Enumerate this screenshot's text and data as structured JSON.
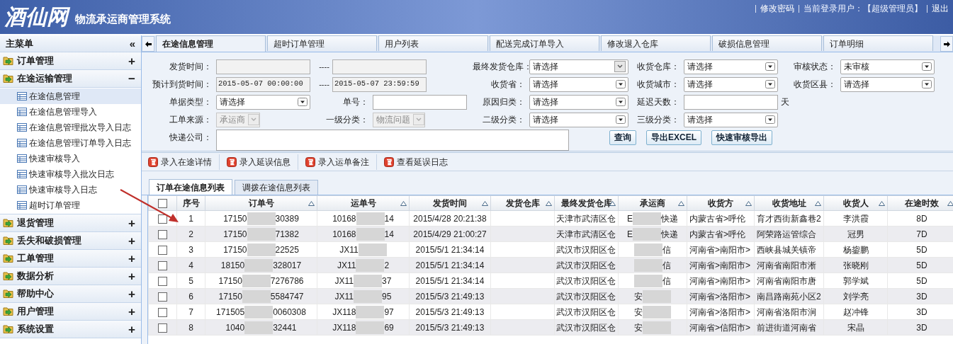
{
  "header": {
    "logo": "酒仙网",
    "title": "物流承运商管理系统",
    "links": [
      {
        "kind": "link",
        "text": "修改密码"
      },
      {
        "kind": "text",
        "text": "当前登录用户：【超级管理员】"
      },
      {
        "kind": "link",
        "text": "退出"
      }
    ]
  },
  "sidebar": {
    "title": "主菜单",
    "collapse": "«",
    "groups": [
      {
        "label": "订单管理",
        "toggle": "+"
      },
      {
        "label": "在途运输管理",
        "toggle": "−",
        "items": [
          {
            "label": "在途信息管理",
            "selected": true
          },
          {
            "label": "在途信息管理导入",
            "selected": false
          },
          {
            "label": "在途信息管理批次导入日志",
            "selected": false
          },
          {
            "label": "在途信息管理订单导入日志",
            "selected": false
          },
          {
            "label": "快速审核导入",
            "selected": false
          },
          {
            "label": "快速审核导入批次日志",
            "selected": false
          },
          {
            "label": "快速审核导入日志",
            "selected": false
          },
          {
            "label": "超时订单管理",
            "selected": false
          }
        ]
      },
      {
        "label": "退货管理",
        "toggle": "+"
      },
      {
        "label": "丢失和破损管理",
        "toggle": "+"
      },
      {
        "label": "工单管理",
        "toggle": "+"
      },
      {
        "label": "数据分析",
        "toggle": "+"
      },
      {
        "label": "帮助中心",
        "toggle": "+"
      },
      {
        "label": "用户管理",
        "toggle": "+"
      },
      {
        "label": "系统设置",
        "toggle": "+"
      }
    ]
  },
  "tabs": [
    {
      "label": "在途信息管理",
      "selected": true
    },
    {
      "label": "超时订单管理",
      "selected": false
    },
    {
      "label": "用户列表",
      "selected": false
    },
    {
      "label": "配送完成订单导入",
      "selected": false
    },
    {
      "label": "修改退入仓库",
      "selected": false
    },
    {
      "label": "破损信息管理",
      "selected": false
    },
    {
      "label": "订单明细",
      "selected": false
    }
  ],
  "form": {
    "rows": [
      [
        {
          "kind": "date_range",
          "label": "发货时间：",
          "separator": "----"
        },
        {
          "kind": "select_plain",
          "label": "最终发货仓库：",
          "value": "请选择"
        },
        {
          "kind": "select",
          "label": "收货仓库：",
          "value": "请选择"
        },
        {
          "kind": "select",
          "label": "审核状态：",
          "value": "未审核"
        }
      ],
      [
        {
          "kind": "date_range",
          "label": "预计到货时间：",
          "from": "2015-05-07 00:00:00",
          "to": "2015-05-07 23:59:59",
          "separator": "----"
        },
        {
          "kind": "select",
          "label": "收货省：",
          "value": "请选择"
        },
        {
          "kind": "select",
          "label": "收货城市：",
          "value": "请选择"
        },
        {
          "kind": "select",
          "label": "收货区县：",
          "value": "请选择"
        }
      ],
      [
        {
          "kind": "select",
          "label": "单据类型：",
          "value": "请选择"
        },
        {
          "kind": "text",
          "label": "单号："
        },
        {
          "kind": "select",
          "label": "原因归类：",
          "value": "请选择"
        },
        {
          "kind": "text",
          "label": "延迟天数：",
          "suffix": "天"
        }
      ],
      [
        {
          "kind": "disabled_select",
          "label": "工单来源：",
          "value": "承运商"
        },
        {
          "kind": "disabled_select",
          "label": "一级分类：",
          "value": "物流问题"
        },
        {
          "kind": "select",
          "label": "二级分类：",
          "value": "请选择"
        },
        {
          "kind": "select",
          "label": "三级分类：",
          "value": "请选择"
        }
      ],
      [
        {
          "kind": "textarea",
          "label": "快递公司："
        }
      ]
    ],
    "buttons": [
      "查询",
      "导出EXCEL",
      "快速审核导出"
    ]
  },
  "toolbar": [
    "录入在途详情",
    "录入延误信息",
    "录入运单备注",
    "查看延误日志"
  ],
  "list_tabs": [
    {
      "label": "订单在途信息列表",
      "selected": true
    },
    {
      "label": "调拨在途信息列表",
      "selected": false
    }
  ],
  "table": {
    "header_checked": false,
    "columns": [
      "序号",
      "订单号",
      "运单号",
      "发货时间",
      "发货仓库",
      "最终发货仓库",
      "承运商",
      "收货方",
      "收货地址",
      "收货人",
      "在途时效"
    ],
    "rows": [
      {
        "checked": false,
        "no": "1",
        "order": {
          "pre": "17150",
          "post": "30389"
        },
        "waybill": {
          "pre": "10168",
          "post": "14"
        },
        "time": "2015/4/28 20:21:38",
        "final_warehouse": "天津市武清区仓",
        "carrier": {
          "pre": "E",
          "post": "快递"
        },
        "consignee": "内蒙古省>呼伦",
        "address": "育才西街新鑫巷2",
        "receiver": "李洪霞",
        "transit": "8D"
      },
      {
        "checked": false,
        "no": "2",
        "order": {
          "pre": "17150",
          "post": "71382"
        },
        "waybill": {
          "pre": "10168",
          "post": "14"
        },
        "time": "2015/4/29 21:00:27",
        "final_warehouse": "天津市武清区仓",
        "carrier": {
          "pre": "E",
          "post": "快递"
        },
        "consignee": "内蒙古省>呼伦",
        "address": "阿荣路运管综合",
        "receiver": "冠男",
        "transit": "7D"
      },
      {
        "checked": false,
        "no": "3",
        "order": {
          "pre": "17150",
          "post": "22525"
        },
        "waybill": {
          "pre": "JX11"
        },
        "time": "2015/5/1 21:34:14",
        "final_warehouse": "武汉市汉阳区仓",
        "carrier": {
          "post": "信"
        },
        "consignee": "河南省>南阳市>",
        "address": "西峡县城关镇帝",
        "receiver": "杨鋆鹏",
        "transit": "5D"
      },
      {
        "checked": false,
        "no": "4",
        "order": {
          "pre": "18150",
          "post": "328017"
        },
        "waybill": {
          "pre": "JX11",
          "post": "2"
        },
        "time": "2015/5/1 21:34:14",
        "final_warehouse": "武汉市汉阳区仓",
        "carrier": {
          "post": "信"
        },
        "consignee": "河南省>南阳市>",
        "address": "河南省南阳市淅",
        "receiver": "张晓刚",
        "transit": "5D"
      },
      {
        "checked": false,
        "no": "5",
        "order": {
          "pre": "17150",
          "post": "7276786"
        },
        "waybill": {
          "pre": "JX11",
          "post": "37"
        },
        "time": "2015/5/1 21:34:14",
        "final_warehouse": "武汉市汉阳区仓",
        "carrier": {
          "post": "信"
        },
        "consignee": "河南省>南阳市>",
        "address": "河南省南阳市唐",
        "receiver": "郭学斌",
        "transit": "5D"
      },
      {
        "checked": false,
        "no": "6",
        "order": {
          "pre": "17150",
          "post": "5584747"
        },
        "waybill": {
          "pre": "JX11",
          "post": "95"
        },
        "time": "2015/5/3 21:49:13",
        "final_warehouse": "武汉市汉阳区仓",
        "carrier": {
          "pre": "安"
        },
        "consignee": "河南省>洛阳市>",
        "address": "南昌路南苑小区2",
        "receiver": "刘学亮",
        "transit": "3D"
      },
      {
        "checked": false,
        "no": "7",
        "order": {
          "pre": "171505",
          "post": "0060308"
        },
        "waybill": {
          "pre": "JX118",
          "post": "97"
        },
        "time": "2015/5/3 21:49:13",
        "final_warehouse": "武汉市汉阳区仓",
        "carrier": {
          "pre": "安"
        },
        "consignee": "河南省>洛阳市>",
        "address": "河南省洛阳市涧",
        "receiver": "赵冲锋",
        "transit": "3D"
      },
      {
        "checked": false,
        "no": "8",
        "order": {
          "pre": "1040",
          "post": "32441"
        },
        "waybill": {
          "pre": "JX118",
          "post": "69"
        },
        "time": "2015/5/3 21:49:13",
        "final_warehouse": "武汉市汉阳区仓",
        "carrier": {
          "pre": "安"
        },
        "consignee": "河南省>信阳市>",
        "address": "前进街道河南省",
        "receiver": "宋晶",
        "transit": "3D"
      }
    ]
  }
}
